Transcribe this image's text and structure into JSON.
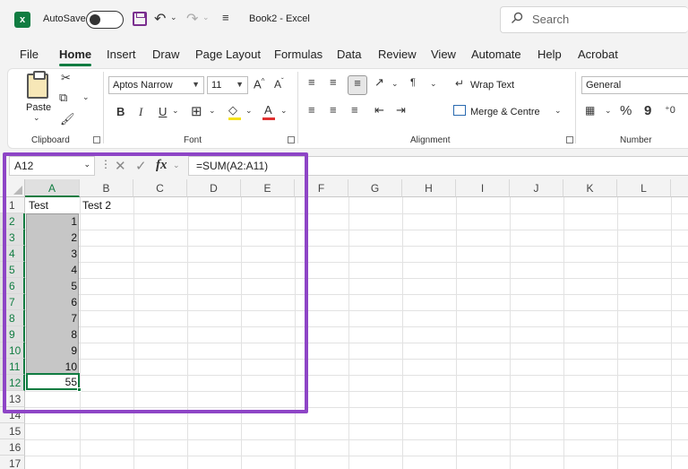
{
  "titlebar": {
    "app_icon_letter": "x",
    "autosave_label": "AutoSave",
    "autosave_state": "Off",
    "document_title": "Book2  -  Excel",
    "search_placeholder": "Search"
  },
  "menu": [
    "File",
    "Home",
    "Insert",
    "Draw",
    "Page Layout",
    "Formulas",
    "Data",
    "Review",
    "View",
    "Automate",
    "Help",
    "Acrobat"
  ],
  "menu_active": "Home",
  "ribbon": {
    "clipboard": {
      "paste_label": "Paste",
      "group_label": "Clipboard"
    },
    "font": {
      "font_name": "Aptos Narrow",
      "font_size": "11",
      "bold": "B",
      "italic": "I",
      "underline": "U",
      "font_color": "A",
      "group_label": "Font"
    },
    "alignment": {
      "wrap_text": "Wrap Text",
      "merge_centre": "Merge & Centre",
      "group_label": "Alignment"
    },
    "number": {
      "format": "General",
      "percent": "%",
      "comma": "9",
      "group_label": "Number"
    }
  },
  "formula_bar": {
    "name_box": "A12",
    "fx_label": "fx",
    "formula": "=SUM(A2:A11)"
  },
  "sheet": {
    "columns": [
      "A",
      "B",
      "C",
      "D",
      "E",
      "F",
      "G",
      "H",
      "I",
      "J",
      "K",
      "L"
    ],
    "rows": [
      "1",
      "2",
      "3",
      "4",
      "5",
      "6",
      "7",
      "8",
      "9",
      "10",
      "11",
      "12",
      "13",
      "14",
      "15",
      "16",
      "17"
    ],
    "cells": {
      "A1": "Test",
      "B1": "Test 2",
      "A2": "1",
      "A3": "2",
      "A4": "3",
      "A5": "4",
      "A6": "5",
      "A7": "6",
      "A8": "7",
      "A9": "8",
      "A10": "9",
      "A11": "10",
      "A12": "55"
    },
    "selected_range": "A2:A11",
    "active_cell": "A12"
  },
  "colors": {
    "excel_green": "#107c41",
    "highlight_purple": "#8e45c6",
    "selection_gray": "#c6c6c6"
  }
}
